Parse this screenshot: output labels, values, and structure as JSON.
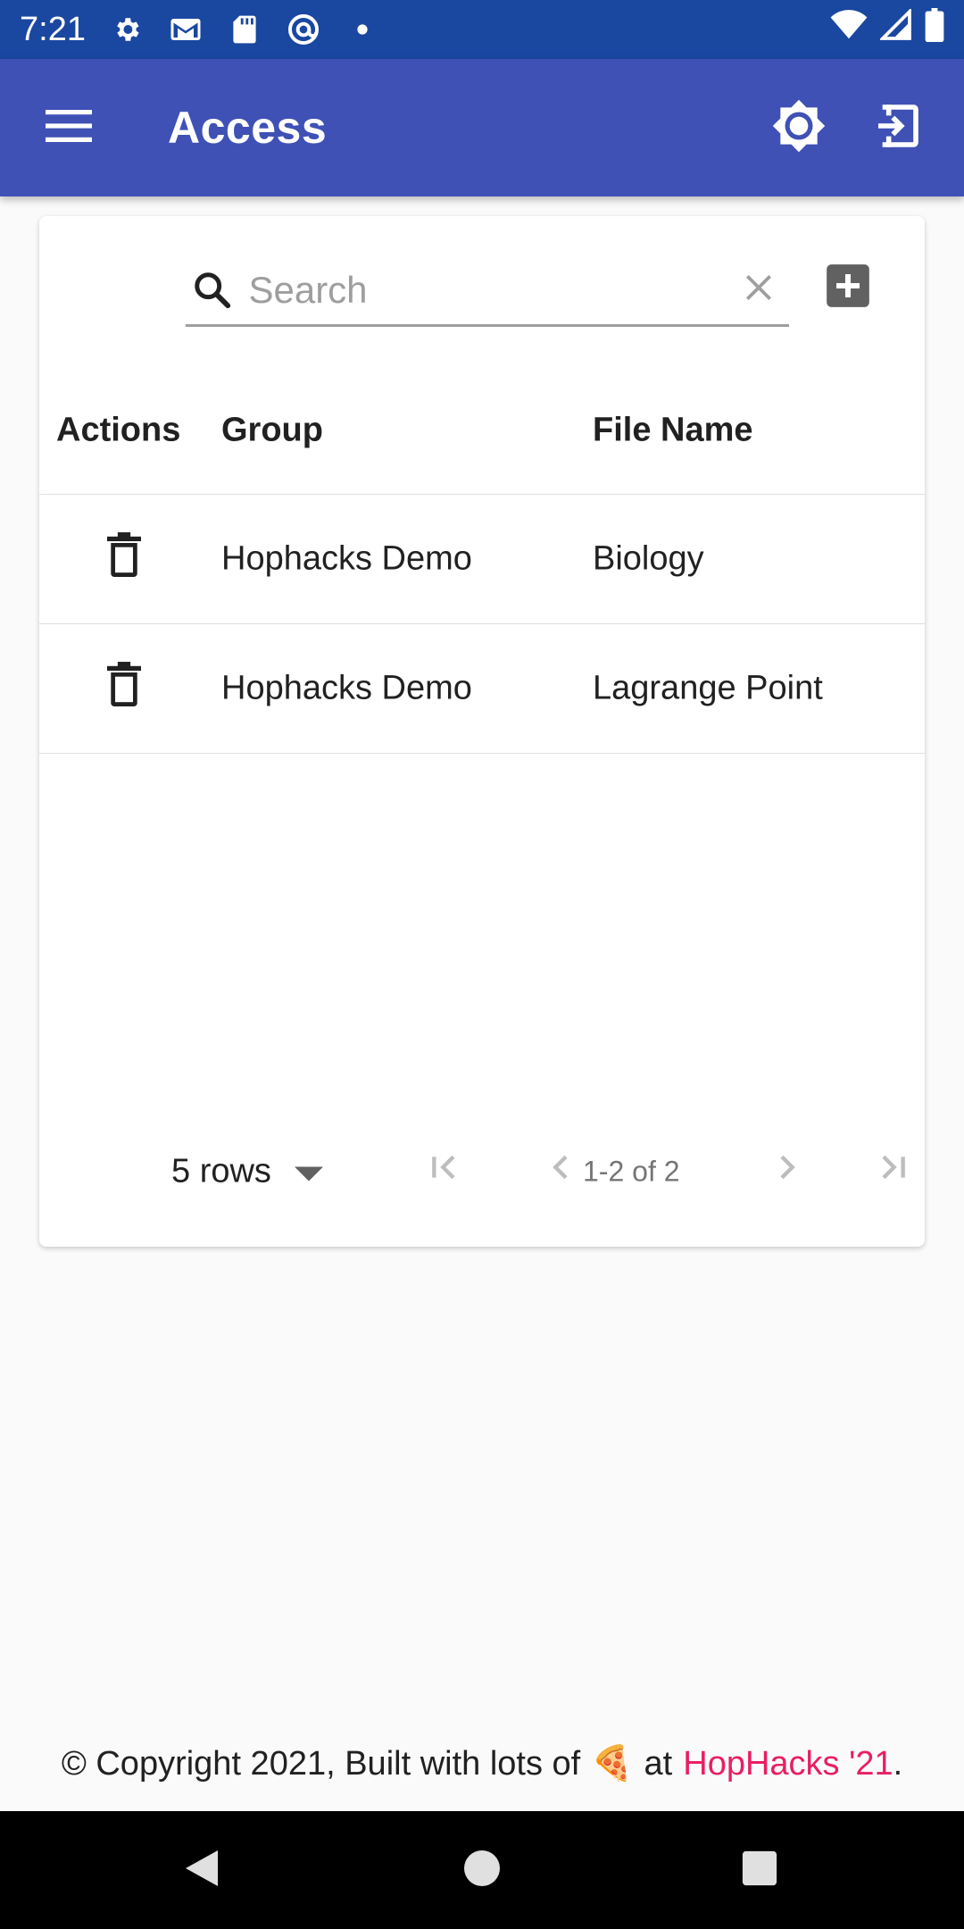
{
  "status_bar": {
    "time": "7:21",
    "icons_left": [
      "gear-icon",
      "gmail-icon",
      "sd-card-icon",
      "at-sign-icon",
      "dot-icon"
    ],
    "icons_right": [
      "wifi-icon",
      "signal-icon",
      "battery-icon"
    ]
  },
  "app_bar": {
    "title": "Access",
    "menu_icon": "menu-icon",
    "theme_icon": "brightness-icon",
    "logout_icon": "logout-icon",
    "color": "#3f51b5"
  },
  "search": {
    "placeholder": "Search",
    "value": ""
  },
  "table": {
    "columns": [
      "Actions",
      "Group",
      "File Name"
    ],
    "rows": [
      {
        "group": "Hophacks Demo",
        "file_name": "Biology"
      },
      {
        "group": "Hophacks Demo",
        "file_name": "Lagrange Point"
      }
    ]
  },
  "pagination": {
    "rows_per_page": "5 rows",
    "range": "1-2 of 2"
  },
  "footer": {
    "prefix": "© Copyright 2021, Built with lots of",
    "emoji": "🍕",
    "at": "at",
    "brand": "HopHacks '21",
    "suffix": ".",
    "brand_color": "#e91e63"
  }
}
